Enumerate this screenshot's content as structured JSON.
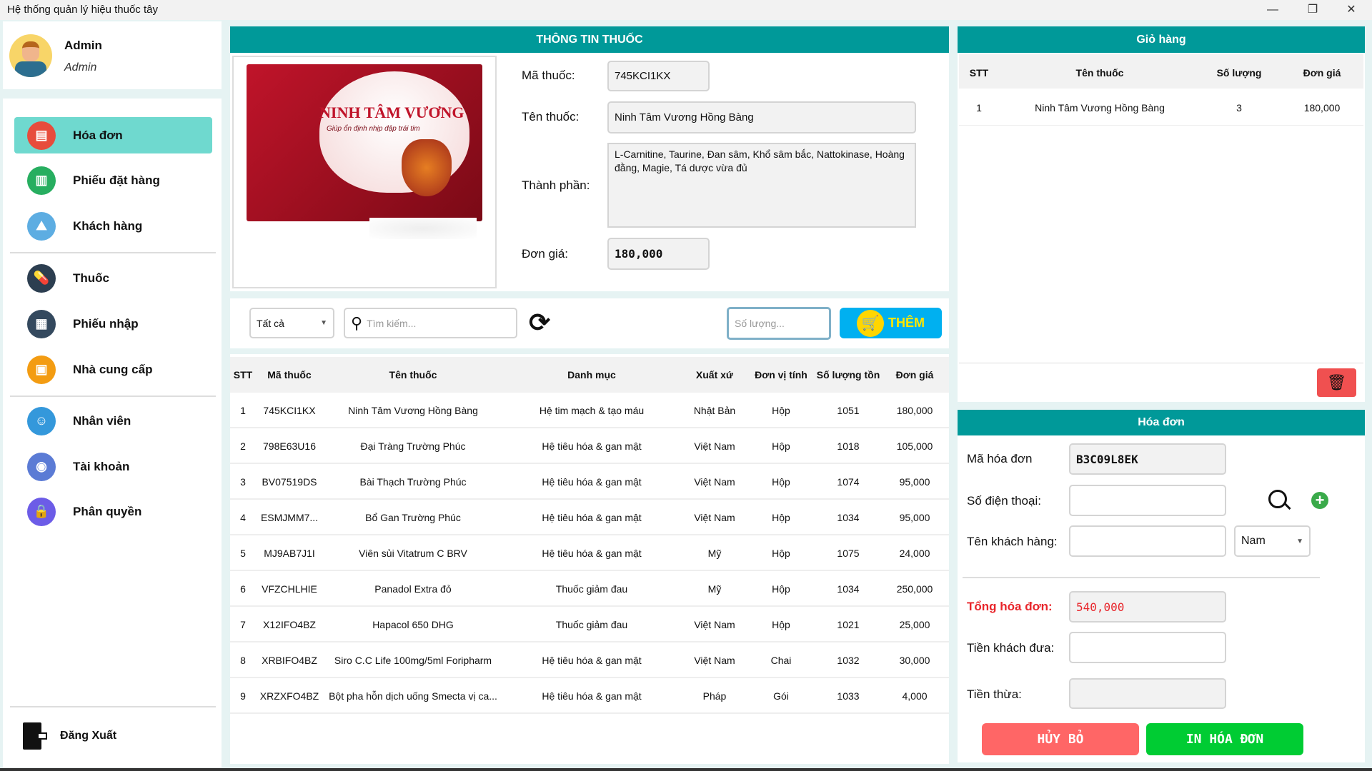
{
  "window": {
    "title": "Hệ thống quản lý hiệu thuốc tây",
    "controls": [
      "minimize",
      "restore",
      "close"
    ]
  },
  "user": {
    "name": "Admin",
    "role": "Admin"
  },
  "sidebar": {
    "items": [
      {
        "label": "Hóa đơn",
        "icon": "invoice-icon",
        "active": true,
        "color": "#e74c3c"
      },
      {
        "label": "Phiếu đặt hàng",
        "icon": "order-form-icon",
        "color": "#27ae60"
      },
      {
        "label": "Khách hàng",
        "icon": "customer-icon",
        "color": "#5dade2"
      },
      {
        "label": "Thuốc",
        "icon": "pill-icon",
        "color": "#2c3e50"
      },
      {
        "label": "Phiếu nhập",
        "icon": "import-form-icon",
        "color": "#34495e"
      },
      {
        "label": "Nhà cung cấp",
        "icon": "supplier-icon",
        "color": "#f39c12"
      },
      {
        "label": "Nhân viên",
        "icon": "employee-icon",
        "color": "#3498db"
      },
      {
        "label": "Tài khoản",
        "icon": "account-icon",
        "color": "#5b7bd5"
      },
      {
        "label": "Phân quyền",
        "icon": "lock-icon",
        "color": "#6c5ce7"
      }
    ],
    "logout": "Đăng Xuất"
  },
  "drug_info": {
    "title": "THÔNG TIN THUỐC",
    "image_text": "NINH TÂM VƯƠNG",
    "image_subtext": "Giúp ổn định nhịp đập trái tim",
    "labels": {
      "code": "Mã thuốc:",
      "name": "Tên thuốc:",
      "ingredients": "Thành phần:",
      "price": "Đơn giá:"
    },
    "code": "745KCI1KX",
    "name": "Ninh Tâm Vương Hồng Bàng",
    "ingredients": "L-Carnitine, Taurine, Đan sâm, Khổ sâm bắc, Nattokinase, Hoàng đằng, Magie, Tá dược vừa đủ",
    "price": "180,000"
  },
  "toolbar": {
    "category": "Tất cả",
    "search_placeholder": "Tìm kiếm...",
    "quantity_placeholder": "Số lượng...",
    "add_label": "THÊM"
  },
  "drug_table": {
    "headers": [
      "STT",
      "Mã thuốc",
      "Tên thuốc",
      "Danh mục",
      "Xuất xứ",
      "Đơn vị tính",
      "Số lượng tồn",
      "Đơn giá"
    ],
    "rows": [
      [
        "1",
        "745KCI1KX",
        "Ninh Tâm Vương Hồng Bàng",
        "Hệ tim mạch & tạo máu",
        "Nhật Bản",
        "Hộp",
        "1051",
        "180,000"
      ],
      [
        "2",
        "798E63U16",
        "Đại Tràng Trường Phúc",
        "Hệ tiêu hóa & gan mật",
        "Việt Nam",
        "Hộp",
        "1018",
        "105,000"
      ],
      [
        "3",
        "BV07519DS",
        "Bài Thạch Trường Phúc",
        "Hệ tiêu hóa & gan mật",
        "Việt Nam",
        "Hộp",
        "1074",
        "95,000"
      ],
      [
        "4",
        "ESMJMM7...",
        "Bổ Gan Trường Phúc",
        "Hệ tiêu hóa & gan mật",
        "Việt Nam",
        "Hộp",
        "1034",
        "95,000"
      ],
      [
        "5",
        "MJ9AB7J1I",
        "Viên sủi Vitatrum C BRV",
        "Hệ tiêu hóa & gan mật",
        "Mỹ",
        "Hộp",
        "1075",
        "24,000"
      ],
      [
        "6",
        "VFZCHLHIE",
        "Panadol Extra đỏ",
        "Thuốc giảm đau",
        "Mỹ",
        "Hộp",
        "1034",
        "250,000"
      ],
      [
        "7",
        "X12IFO4BZ",
        "Hapacol 650 DHG",
        "Thuốc giảm đau",
        "Việt Nam",
        "Hộp",
        "1021",
        "25,000"
      ],
      [
        "8",
        "XRBIFO4BZ",
        "Siro C.C Life 100mg/5ml Foripharm",
        "Hệ tiêu hóa & gan mật",
        "Việt Nam",
        "Chai",
        "1032",
        "30,000"
      ],
      [
        "9",
        "XRZXFO4BZ",
        "Bột pha hỗn dịch uống Smecta vị ca...",
        "Hệ tiêu hóa & gan mật",
        "Pháp",
        "Gói",
        "1033",
        "4,000"
      ]
    ]
  },
  "cart": {
    "title": "Giỏ hàng",
    "headers": [
      "STT",
      "Tên thuốc",
      "Số lượng",
      "Đơn giá"
    ],
    "rows": [
      [
        "1",
        "Ninh Tâm Vương Hồng Bàng",
        "3",
        "180,000"
      ]
    ]
  },
  "invoice": {
    "title": "Hóa đơn",
    "labels": {
      "code": "Mã hóa đơn",
      "phone": "Số điện thoại:",
      "customer": "Tên khách hàng:",
      "total": "Tổng hóa đơn:",
      "paid": "Tiền khách đưa:",
      "change": "Tiền thừa:"
    },
    "code": "B3C09L8EK",
    "phone": "",
    "customer": "",
    "gender": "Nam",
    "total": "540,000",
    "paid": "",
    "change": "",
    "cancel_label": "HỦY BỎ",
    "print_label": "IN HÓA ĐƠN"
  },
  "colors": {
    "header": "#009999",
    "active_nav": "#6fd9cf",
    "add_button": "#00b0f0",
    "cancel": "#ff6666",
    "print": "#00cc33",
    "total_text": "#e8252b"
  }
}
